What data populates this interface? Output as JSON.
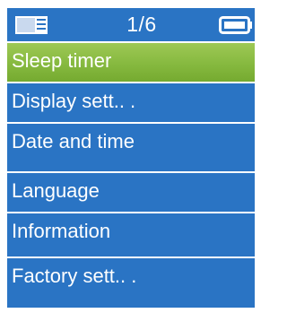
{
  "status_bar": {
    "page_indicator": "1/6",
    "left_icon": "folder-icon",
    "right_icon": "battery-icon"
  },
  "menu": {
    "items": [
      {
        "label": "Sleep timer",
        "selected": true
      },
      {
        "label": "Display sett.. .",
        "selected": false
      },
      {
        "label": "Date and time",
        "selected": false
      },
      {
        "label": "Language",
        "selected": false
      },
      {
        "label": "Information",
        "selected": false
      },
      {
        "label": "Factory sett.. .",
        "selected": false
      }
    ]
  },
  "colors": {
    "background": "#2a74c4",
    "selected_highlight": "#86b93f",
    "text": "#ffffff",
    "separator": "#ffffff"
  }
}
